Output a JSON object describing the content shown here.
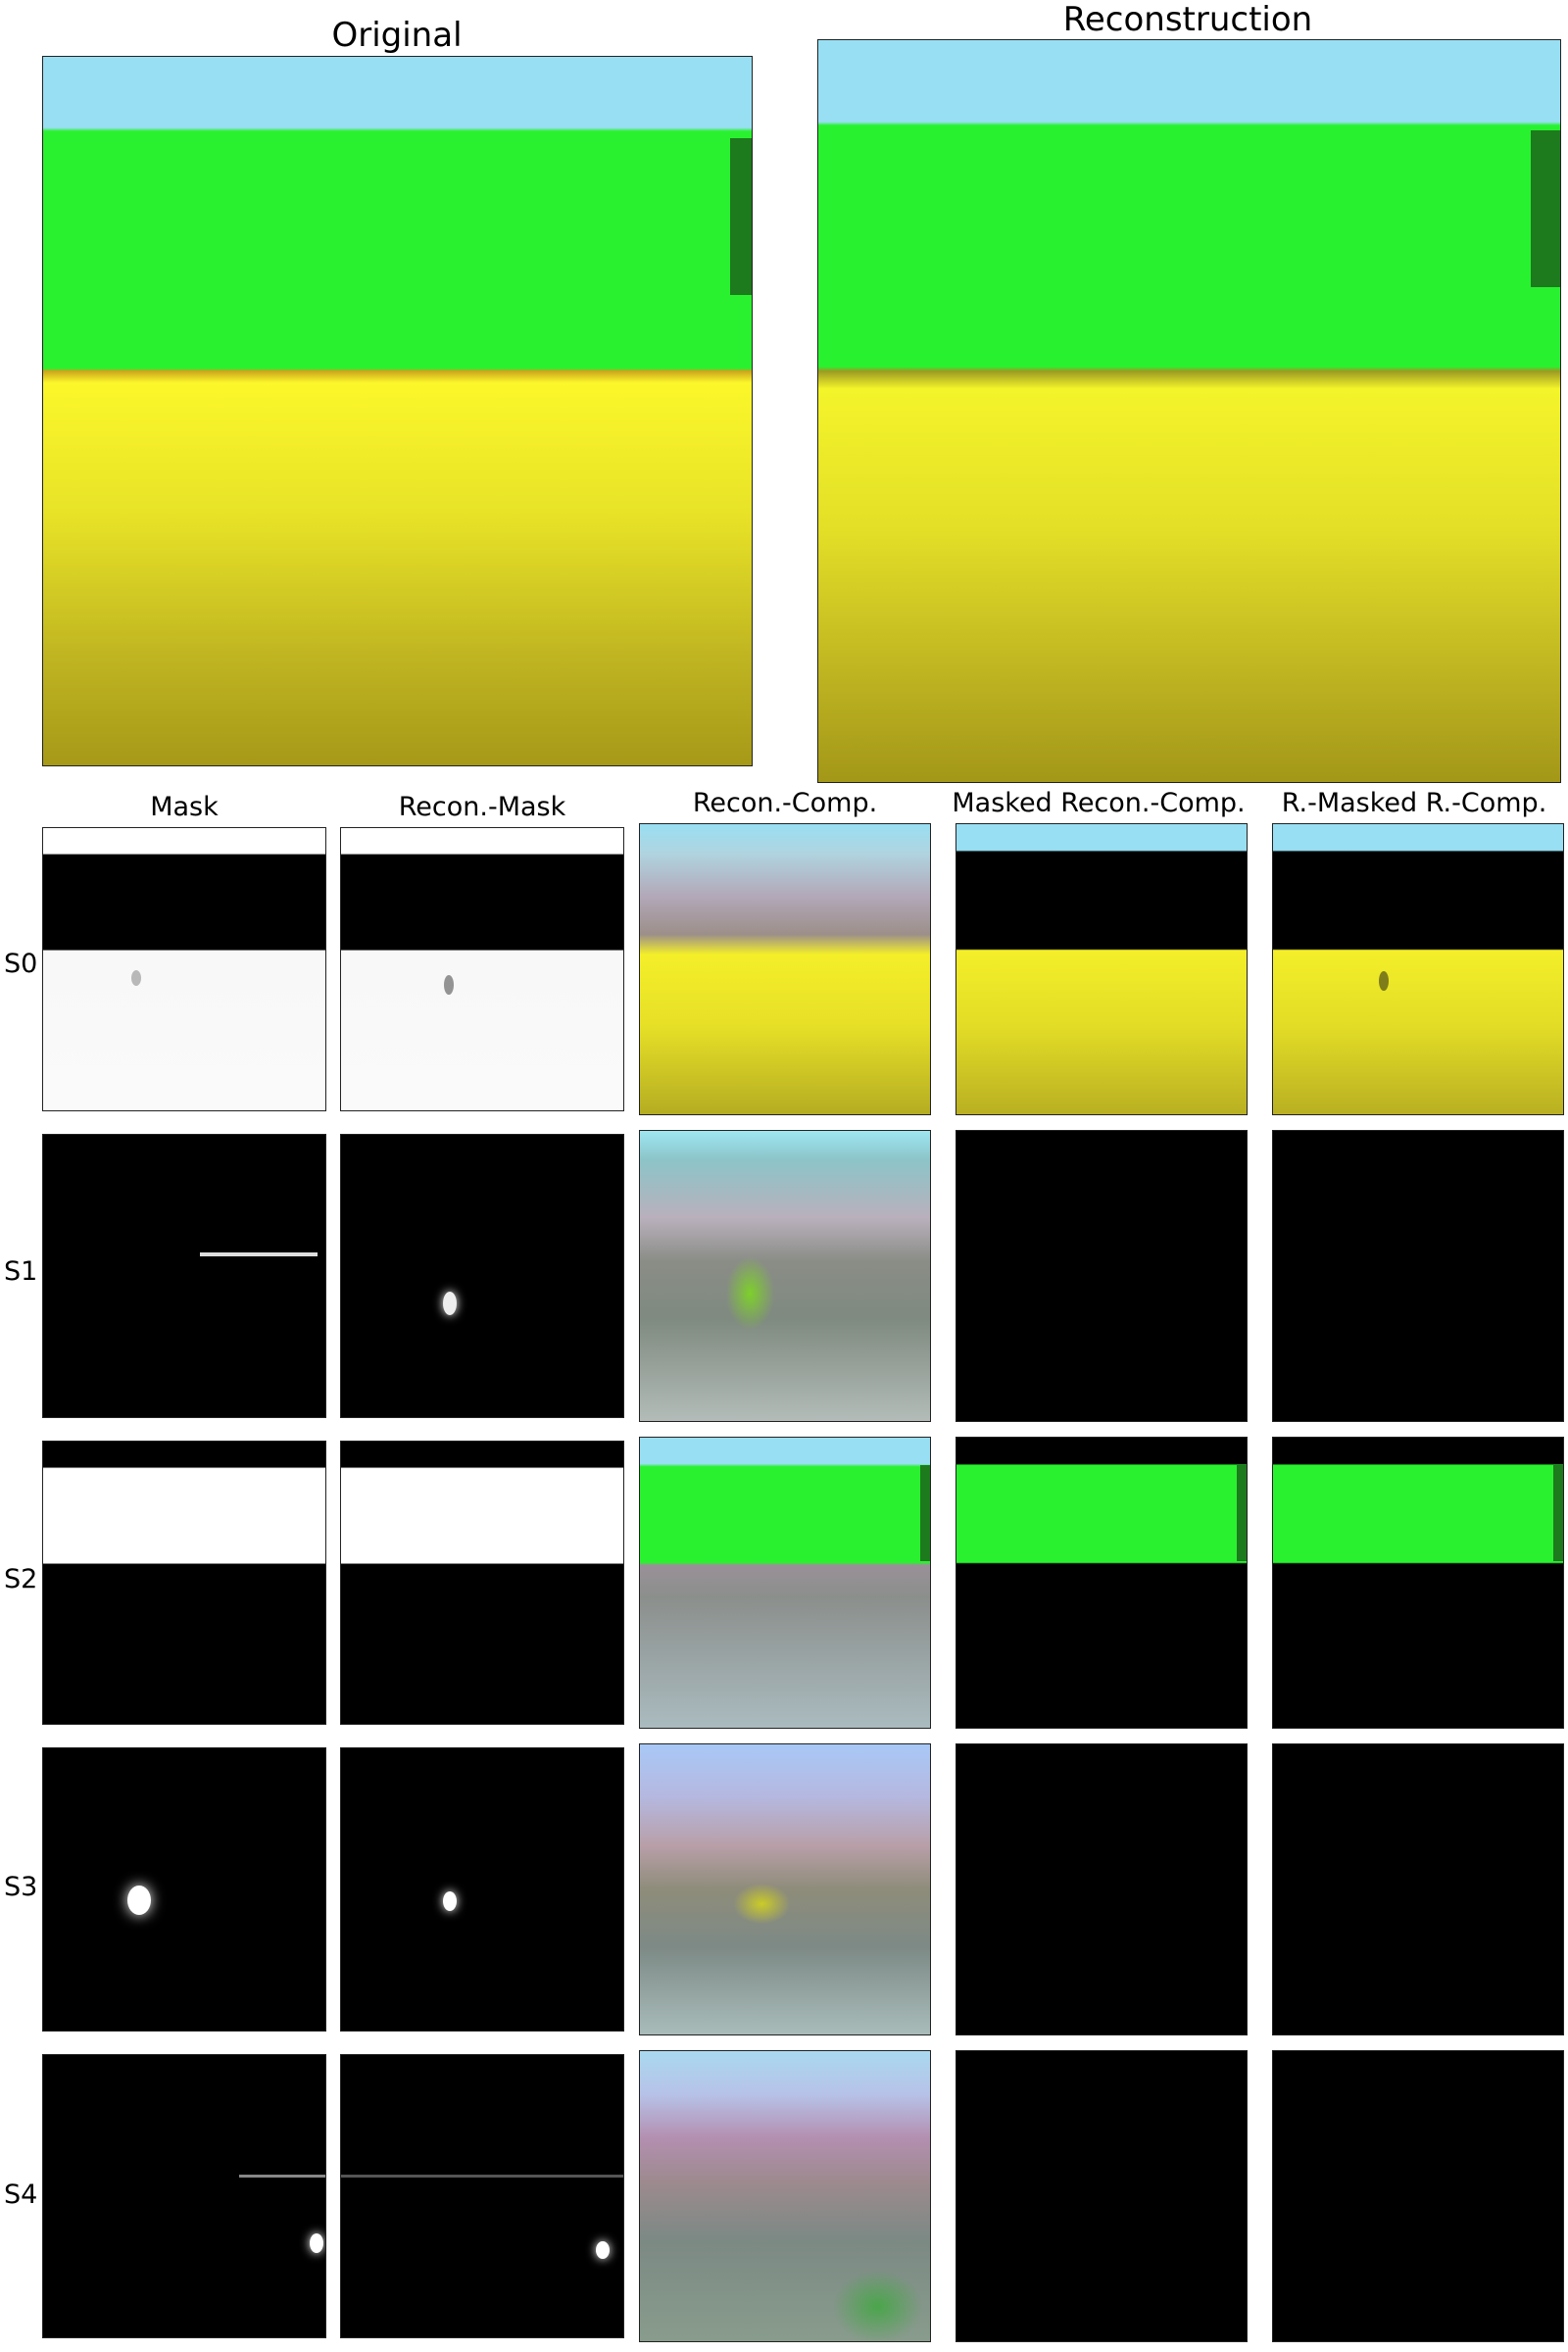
{
  "titles": {
    "original": "Original",
    "reconstruction": "Reconstruction"
  },
  "columns": [
    "Mask",
    "Recon.-Mask",
    "Recon.-Comp.",
    "Masked Recon.-Comp.",
    "R.-Masked R.-Comp."
  ],
  "rows": [
    "S0",
    "S1",
    "S2",
    "S3",
    "S4"
  ]
}
